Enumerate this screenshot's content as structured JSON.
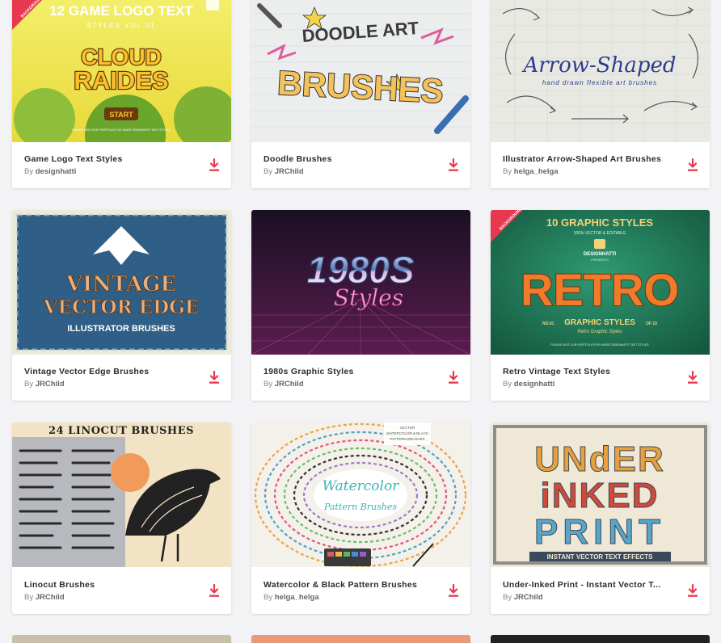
{
  "colors": {
    "accent": "#e8384f",
    "page_bg": "#f3f3f5"
  },
  "by_prefix": "By",
  "cards": [
    {
      "title": "Game Logo Text Styles",
      "author": "designhatti",
      "thumb": {
        "line1": "12 GAME LOGO TEXT",
        "line2": "STYLES VOL 01",
        "big1": "CLOUD",
        "big2": "RAIDES",
        "button": "START",
        "ribbon": "BACKGROUND INCLUDED",
        "fine": "PLEASE VISIT OUR PORTFOLIO FOR MORE DESIGNHATTI TEXT STYLES"
      }
    },
    {
      "title": "Doodle Brushes",
      "author": "JRChild",
      "thumb": {
        "line1": "DOODLE ART",
        "big1": "BRUSHES"
      }
    },
    {
      "title": "Illustrator Arrow-Shaped Art Brushes",
      "author": "helga_helga",
      "thumb": {
        "big1": "Arrow-Shaped",
        "line1": "hand drawn flexible art brushes"
      }
    },
    {
      "title": "Vintage Vector Edge Brushes",
      "author": "JRChild",
      "thumb": {
        "big1": "VINTAGE",
        "big2": "VECTOR EDGE",
        "line1": "ILLUSTRATOR BRUSHES"
      }
    },
    {
      "title": "1980s Graphic Styles",
      "author": "JRChild",
      "thumb": {
        "big1": "1980S",
        "big2": "Styles"
      }
    },
    {
      "title": "Retro Vintage Text Styles",
      "author": "designhatti",
      "thumb": {
        "line1": "10 GRAPHIC STYLES",
        "line2": "100% VECTOR & EDITABLE",
        "brand": "DESIGNHATTI",
        "presents": "PRESENTS",
        "big1": "RETRO",
        "line3": "GRAPHIC STYLES",
        "no1": "NO.01",
        "of": "OF 10",
        "script": "Retro Graphic Styles",
        "ribbon": "BACKGROUND INCLUDED",
        "fine": "PLEASE VISIT OUR PORTFOLIO FOR MORE DESIGNHATTI TEXT STYLES"
      }
    },
    {
      "title": "Linocut Brushes",
      "author": "JRChild",
      "thumb": {
        "line1": "24 LINOCUT BRUSHES"
      }
    },
    {
      "title": "Watercolor & Black Pattern Brushes",
      "author": "helga_helga",
      "thumb": {
        "big1": "Watercolor",
        "big2": "Pattern Brushes",
        "tag1": "VECTOR",
        "tag2": "WATERCOLOR & BLACK",
        "tag3": "PATTERN BRUSHES"
      }
    },
    {
      "title": "Under-Inked Print - Instant Vector T...",
      "author": "JRChild",
      "thumb": {
        "big1": "UNdER",
        "big2": "iNKED",
        "big3": "PRINT",
        "line1": "INSTANT VECTOR TEXT EFFECTS"
      }
    }
  ]
}
